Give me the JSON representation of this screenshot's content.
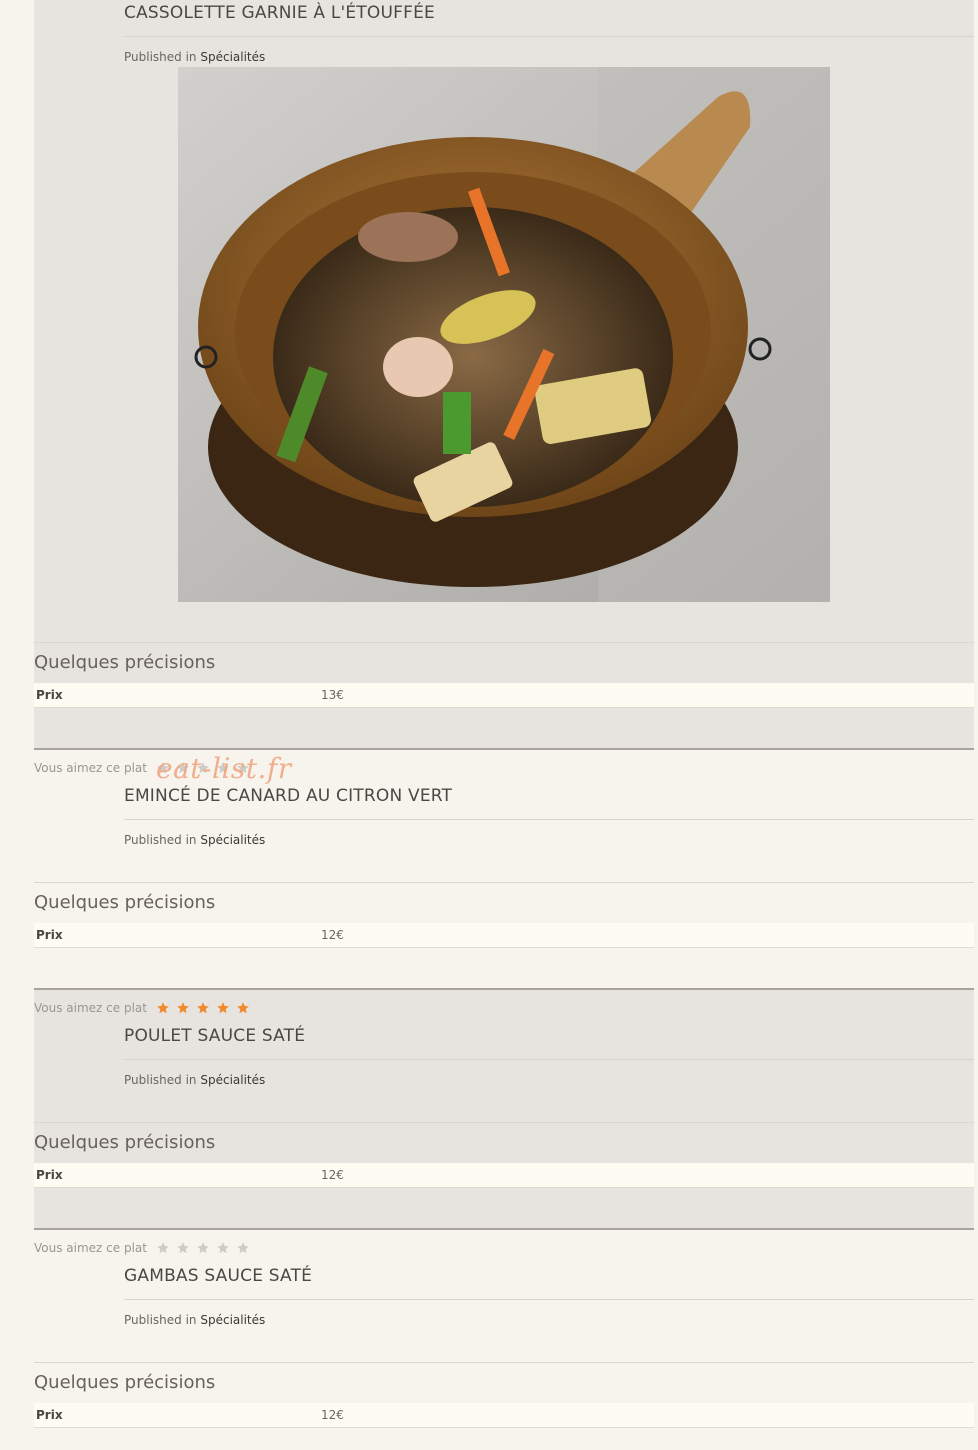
{
  "items": [
    {
      "title": "CASSOLETTE GARNIE À L'ÉTOUFFÉE",
      "published_prefix": "Published in",
      "category": "Spécialités",
      "section_title": "Quelques précisions",
      "prix_label": "Prix",
      "prix_value": "13€",
      "has_photo": true
    },
    {
      "rating_label": "Vous aimez ce plat",
      "rating": 0,
      "title": "EMINCÉ DE CANARD AU CITRON VERT",
      "published_prefix": "Published in",
      "category": "Spécialités",
      "section_title": "Quelques précisions",
      "prix_label": "Prix",
      "prix_value": "12€"
    },
    {
      "rating_label": "Vous aimez ce plat",
      "rating": 5,
      "title": "POULET SAUCE SATÉ",
      "published_prefix": "Published in",
      "category": "Spécialités",
      "section_title": "Quelques précisions",
      "prix_label": "Prix",
      "prix_value": "12€"
    },
    {
      "rating_label": "Vous aimez ce plat",
      "rating": 0,
      "title": "GAMBAS SAUCE SATÉ",
      "published_prefix": "Published in",
      "category": "Spécialités",
      "section_title": "Quelques précisions",
      "prix_label": "Prix",
      "prix_value": "12€"
    }
  ],
  "watermark": "eat-list.fr",
  "colors": {
    "star_on": "#f08a2c",
    "star_off": "#cfcbc6",
    "shaded_bg": "#e7e4df",
    "page_bg": "#f7f4ee",
    "prix_bg": "#fdfcf2"
  },
  "icons": [
    "star-icon"
  ]
}
